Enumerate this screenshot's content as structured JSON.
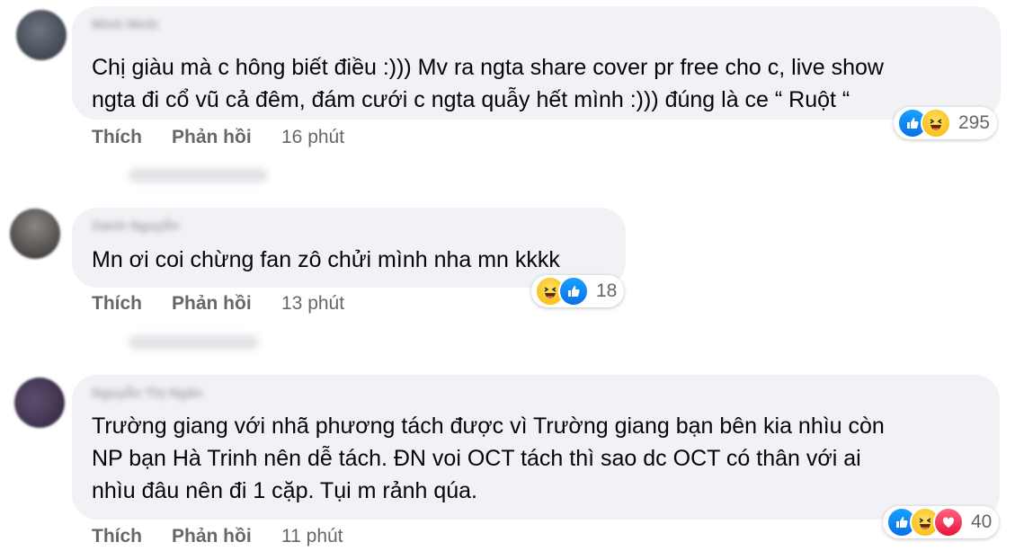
{
  "comments": [
    {
      "author": "Minh Minh",
      "lines": [
        "Chị giàu mà c hông biết điều :))) Mv ra ngta share cover pr free cho c, live show",
        "ngta đi cổ vũ cả đêm, đám cưới c ngta quẫy hết mình :))) đúng là ce “ Ruột “"
      ],
      "like_label": "Thích",
      "reply_label": "Phản hồi",
      "time": "16 phút",
      "reactions": [
        "like-icon",
        "haha-icon"
      ],
      "reaction_count": "295",
      "hidden_replies": "15 phản hồi"
    },
    {
      "author": "Oanh Nguyễn",
      "lines": [
        "Mn ơi coi chừng fan zô chửi mình nha mn kkkk"
      ],
      "like_label": "Thích",
      "reply_label": "Phản hồi",
      "time": "13 phút",
      "reactions": [
        "haha-icon",
        "like-icon"
      ],
      "reaction_count": "18",
      "hidden_replies": "15 phản hồi"
    },
    {
      "author": "Nguyễn Thị Ngân",
      "lines": [
        "Trường giang với nhã phương tách được vì Trường giang bạn bên kia nhìu còn",
        "NP bạn Hà Trinh nên dễ tách. ĐN voi OCT tách thì sao dc OCT có thân với ai",
        "nhìu đâu nên đi 1 cặp. Tụi m rảnh qúa."
      ],
      "like_label": "Thích",
      "reply_label": "Phản hồi",
      "time": "11 phút",
      "reactions": [
        "like-icon",
        "haha-icon",
        "love-icon"
      ],
      "reaction_count": "40"
    }
  ],
  "colors": {
    "bubble": "#f0f2f5",
    "secondary_text": "#65676b",
    "like_blue": "#1877f2",
    "haha_yellow": "#f7b500",
    "love_red": "#f33e58"
  }
}
